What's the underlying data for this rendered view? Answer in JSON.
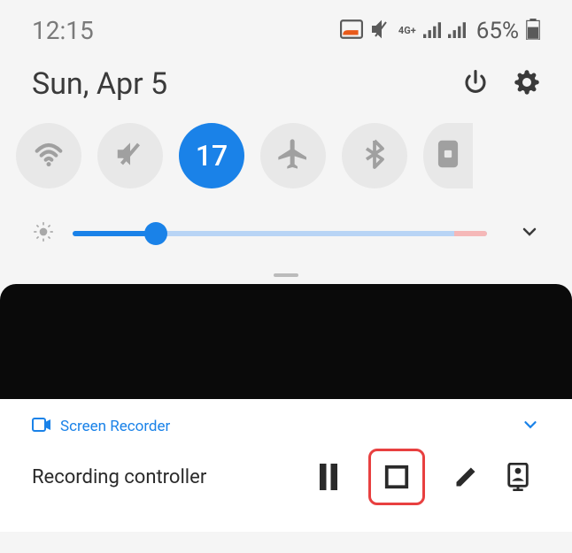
{
  "status": {
    "time": "12:15",
    "network_label": "4G+",
    "battery_percent": "65%"
  },
  "header": {
    "date": "Sun, Apr 5"
  },
  "toggles": {
    "active_value": "17"
  },
  "brightness": {
    "percent": 20
  },
  "notification": {
    "app_name": "Screen Recorder",
    "title": "Recording controller"
  },
  "colors": {
    "accent": "#1a82e8",
    "highlight": "#e84040"
  }
}
